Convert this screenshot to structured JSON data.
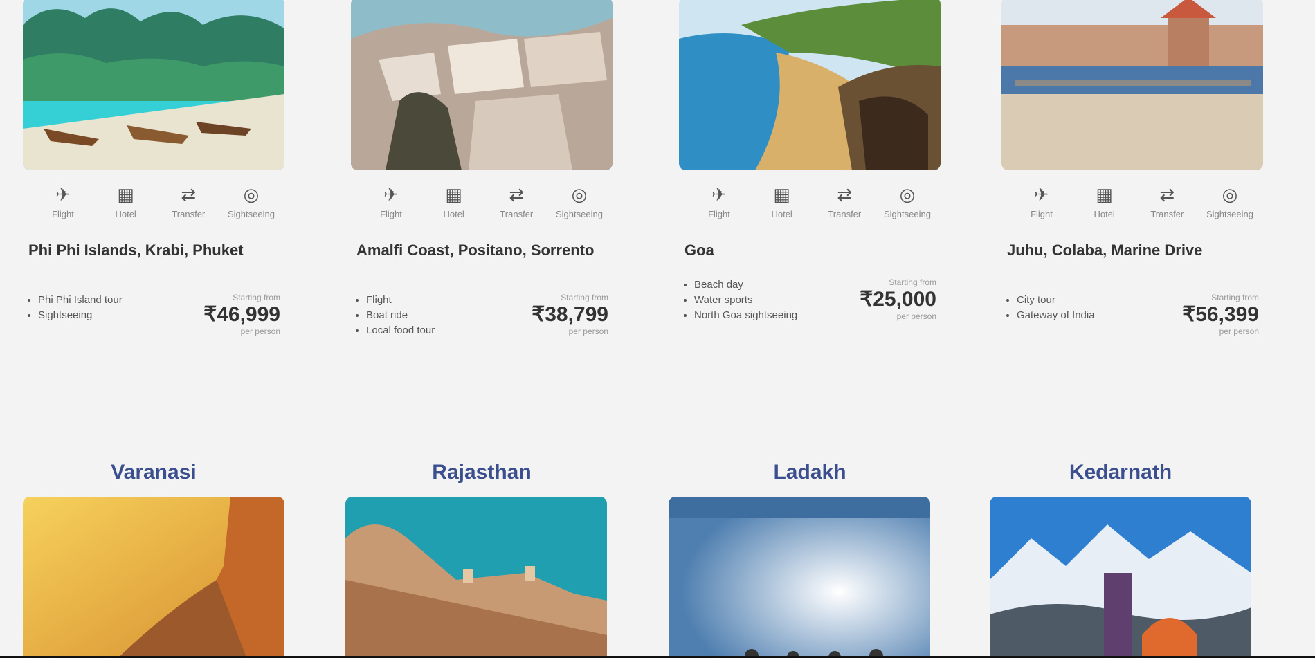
{
  "packages": [
    {
      "icon_labels": [
        "Flight",
        "Hotel",
        "Transfer",
        "Sightseeing"
      ],
      "route": "Phi Phi Islands, Krabi, Phuket",
      "inclusions": [
        "Phi Phi Island tour",
        "Sightseeing"
      ],
      "price_from": "Starting from",
      "price": "₹46,999",
      "price_per": "per person"
    },
    {
      "icon_labels": [
        "Flight",
        "Hotel",
        "Transfer",
        "Sightseeing"
      ],
      "route": "Amalfi Coast, Positano, Sorrento",
      "inclusions": [
        "Flight",
        "Boat ride",
        "Local food tour"
      ],
      "price_from": "Starting from",
      "price": "₹38,799",
      "price_per": "per person"
    },
    {
      "icon_labels": [
        "Flight",
        "Hotel",
        "Transfer",
        "Sightseeing"
      ],
      "route": "Goa",
      "inclusions": [
        "Beach day",
        "Water sports",
        "North Goa sightseeing"
      ],
      "price_from": "Starting from",
      "price": "₹25,000",
      "price_per": "per person"
    },
    {
      "icon_labels": [
        "Flight",
        "Hotel",
        "Transfer",
        "Sightseeing"
      ],
      "route": "Juhu, Colaba, Marine Drive",
      "inclusions": [
        "City tour",
        "Gateway of India"
      ],
      "price_from": "Starting from",
      "price": "₹56,399",
      "price_per": "per person"
    }
  ],
  "destinations": [
    {
      "title": "Varanasi"
    },
    {
      "title": "Rajasthan"
    },
    {
      "title": "Ladakh"
    },
    {
      "title": "Kedarnath"
    }
  ],
  "icons": [
    "flight-icon",
    "hotel-icon",
    "transfer-icon",
    "sightseeing-icon"
  ],
  "colors": {
    "background": "#f3f3f3",
    "destination_title": "#3b4f8e"
  }
}
